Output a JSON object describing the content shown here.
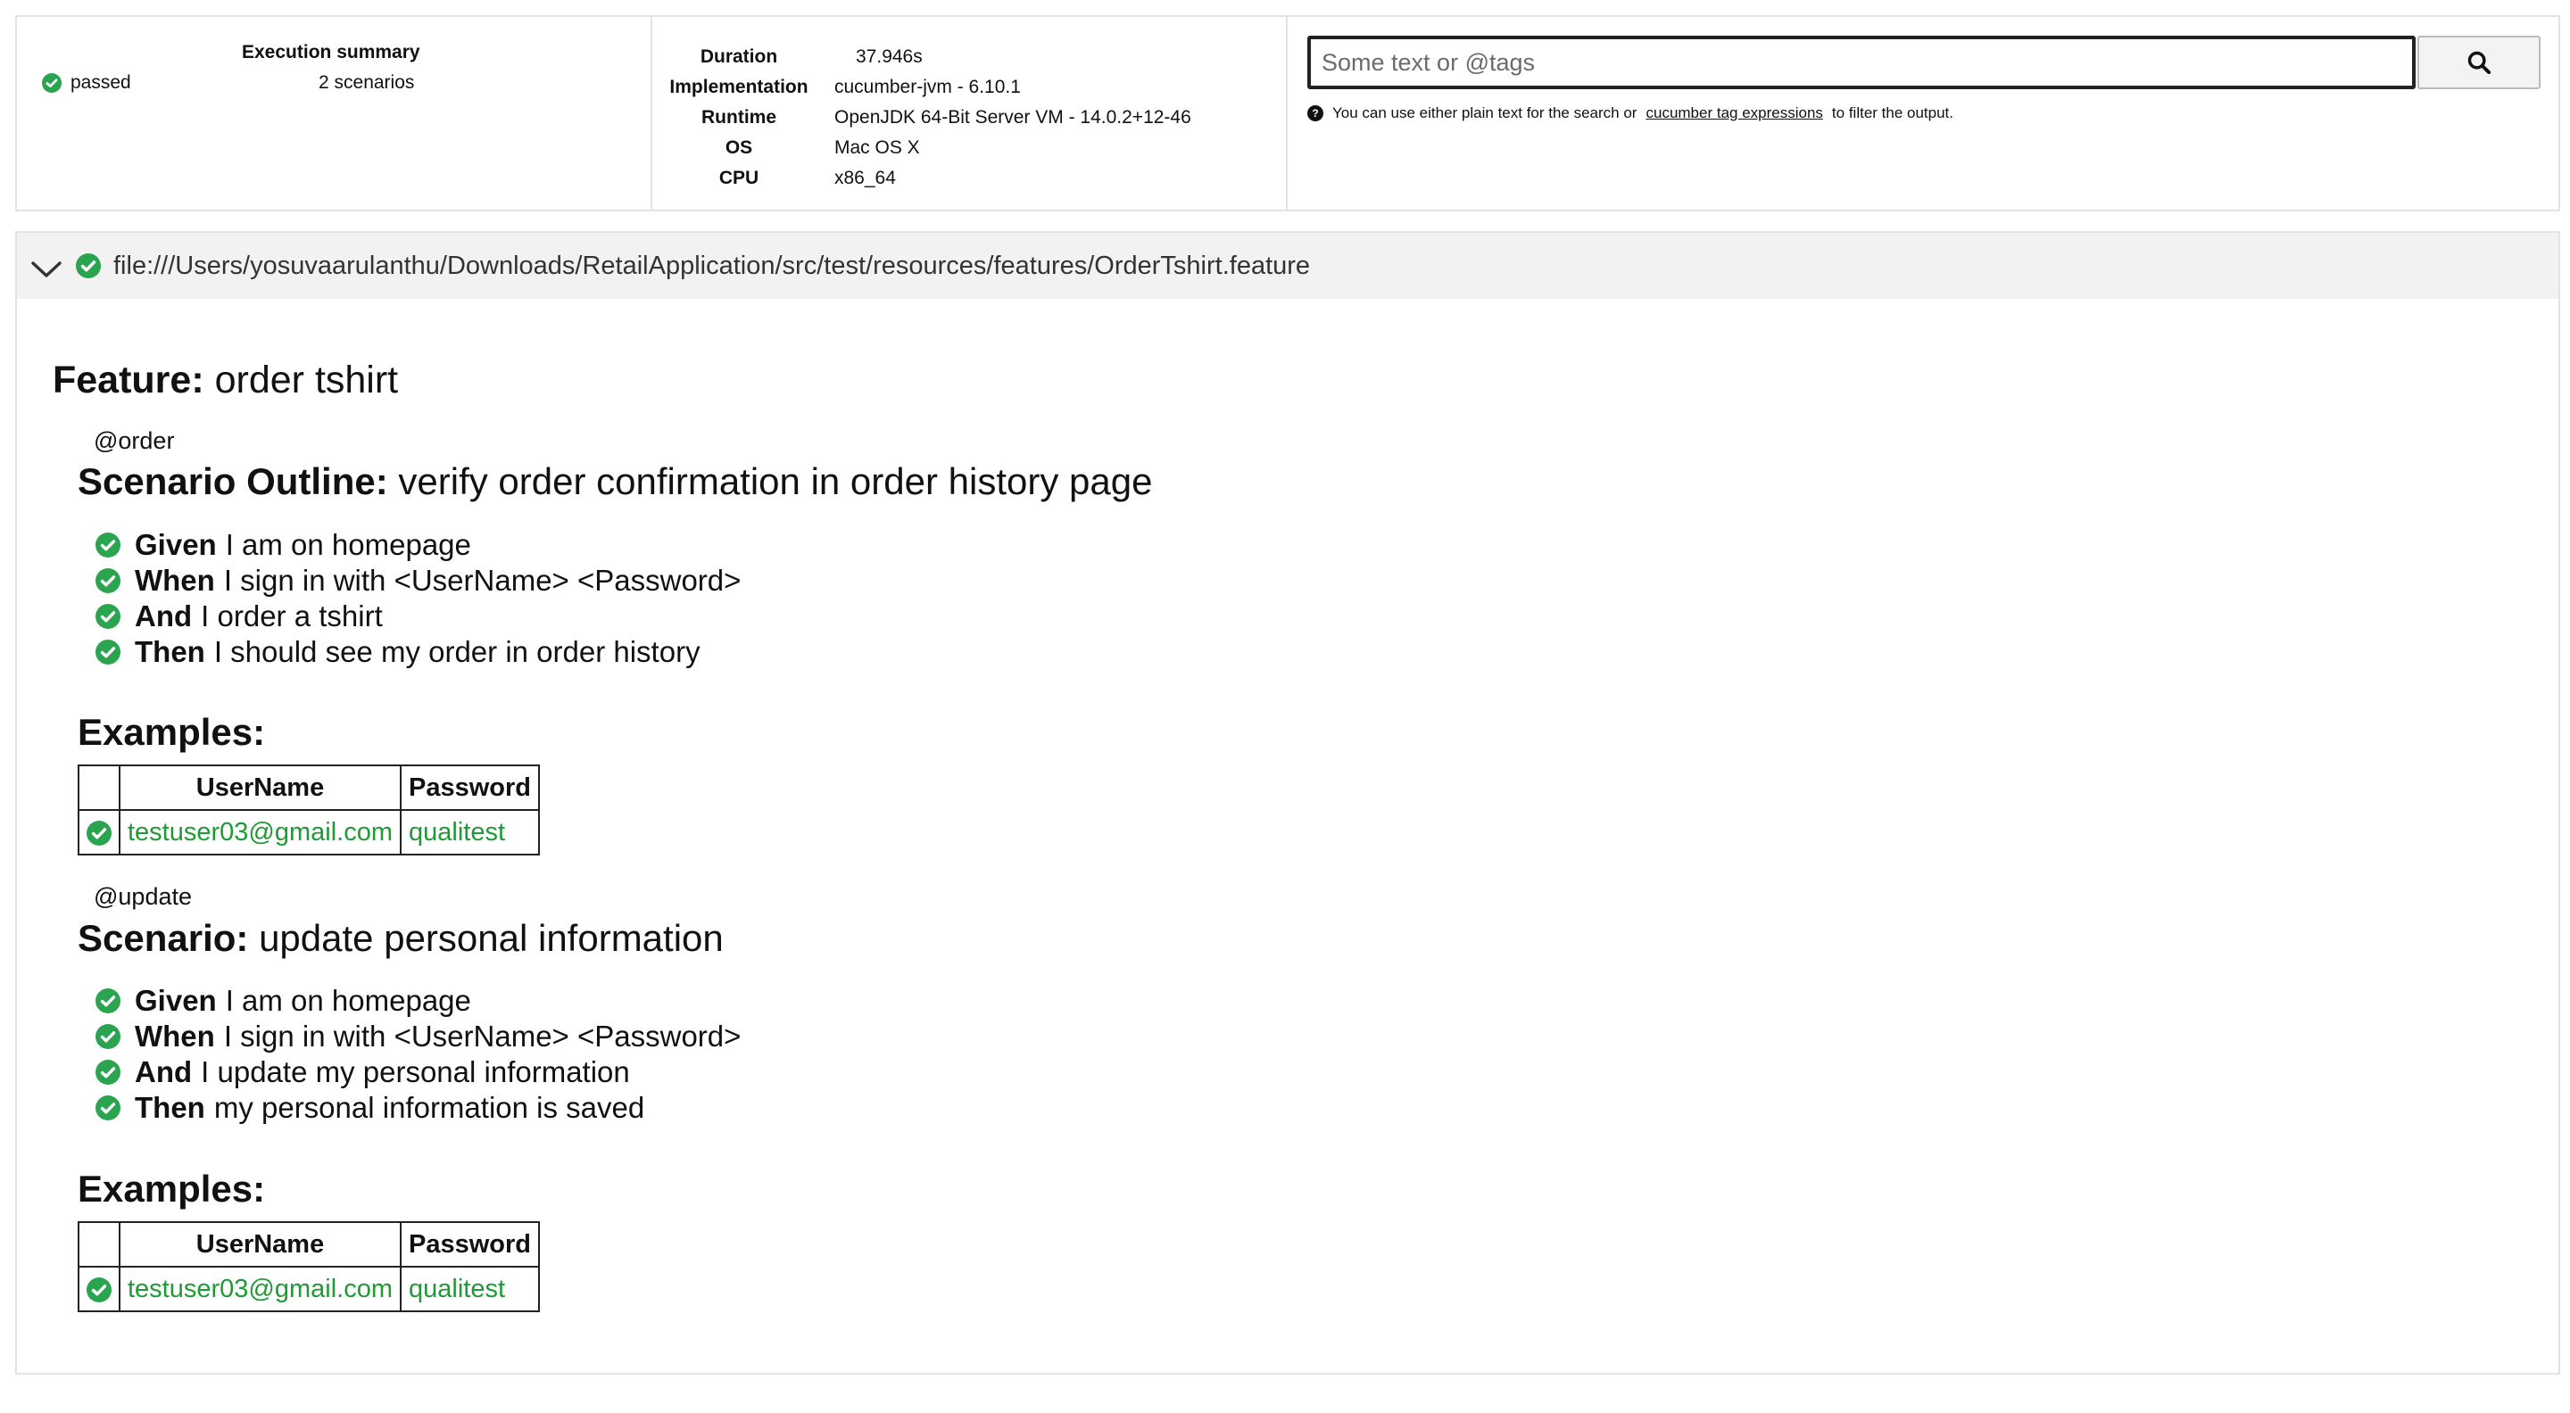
{
  "colors": {
    "passed": "#2aa44f",
    "text": "#111111",
    "border": "#e3e3e3",
    "example_value": "#1f9a36"
  },
  "summary": {
    "title": "Execution summary",
    "status": "passed",
    "scenarios": "2 scenarios"
  },
  "meta": [
    {
      "key": "Duration",
      "value": "37.946s"
    },
    {
      "key": "Implementation",
      "value": "cucumber-jvm - 6.10.1"
    },
    {
      "key": "Runtime",
      "value": "OpenJDK 64-Bit Server VM - 14.0.2+12-46"
    },
    {
      "key": "OS",
      "value": "Mac OS X"
    },
    {
      "key": "CPU",
      "value": "x86_64"
    }
  ],
  "search": {
    "placeholder": "Some text or @tags",
    "value": "",
    "button_icon": "search-icon",
    "help_prefix": "You can use either plain text for the search or",
    "help_link": "cucumber tag expressions",
    "help_suffix": "to filter the output."
  },
  "feature": {
    "uri": "file:///Users/yosuvaarulanthu/Downloads/RetailApplication/src/test/resources/features/OrderTshirt.feature",
    "keyword": "Feature:",
    "name": "order tshirt",
    "scenarios": [
      {
        "tag": "@order",
        "keyword": "Scenario Outline:",
        "name": "verify order confirmation in order history page",
        "steps": [
          {
            "keyword": "Given",
            "text": "I am on homepage"
          },
          {
            "keyword": "When",
            "text": "I sign in with <UserName> <Password>"
          },
          {
            "keyword": "And",
            "text": "I order a tshirt"
          },
          {
            "keyword": "Then",
            "text": "I should see my order in order history"
          }
        ],
        "examples": {
          "keyword": "Examples:",
          "headers": [
            "UserName",
            "Password"
          ],
          "rows": [
            [
              "testuser03@gmail.com",
              "qualitest"
            ]
          ]
        }
      },
      {
        "tag": "@update",
        "keyword": "Scenario:",
        "name": "update personal information",
        "steps": [
          {
            "keyword": "Given",
            "text": "I am on homepage"
          },
          {
            "keyword": "When",
            "text": "I sign in with <UserName> <Password>"
          },
          {
            "keyword": "And",
            "text": "I update my personal information"
          },
          {
            "keyword": "Then",
            "text": "my personal information is saved"
          }
        ],
        "examples": {
          "keyword": "Examples:",
          "headers": [
            "UserName",
            "Password"
          ],
          "rows": [
            [
              "testuser03@gmail.com",
              "qualitest"
            ]
          ]
        }
      }
    ]
  }
}
